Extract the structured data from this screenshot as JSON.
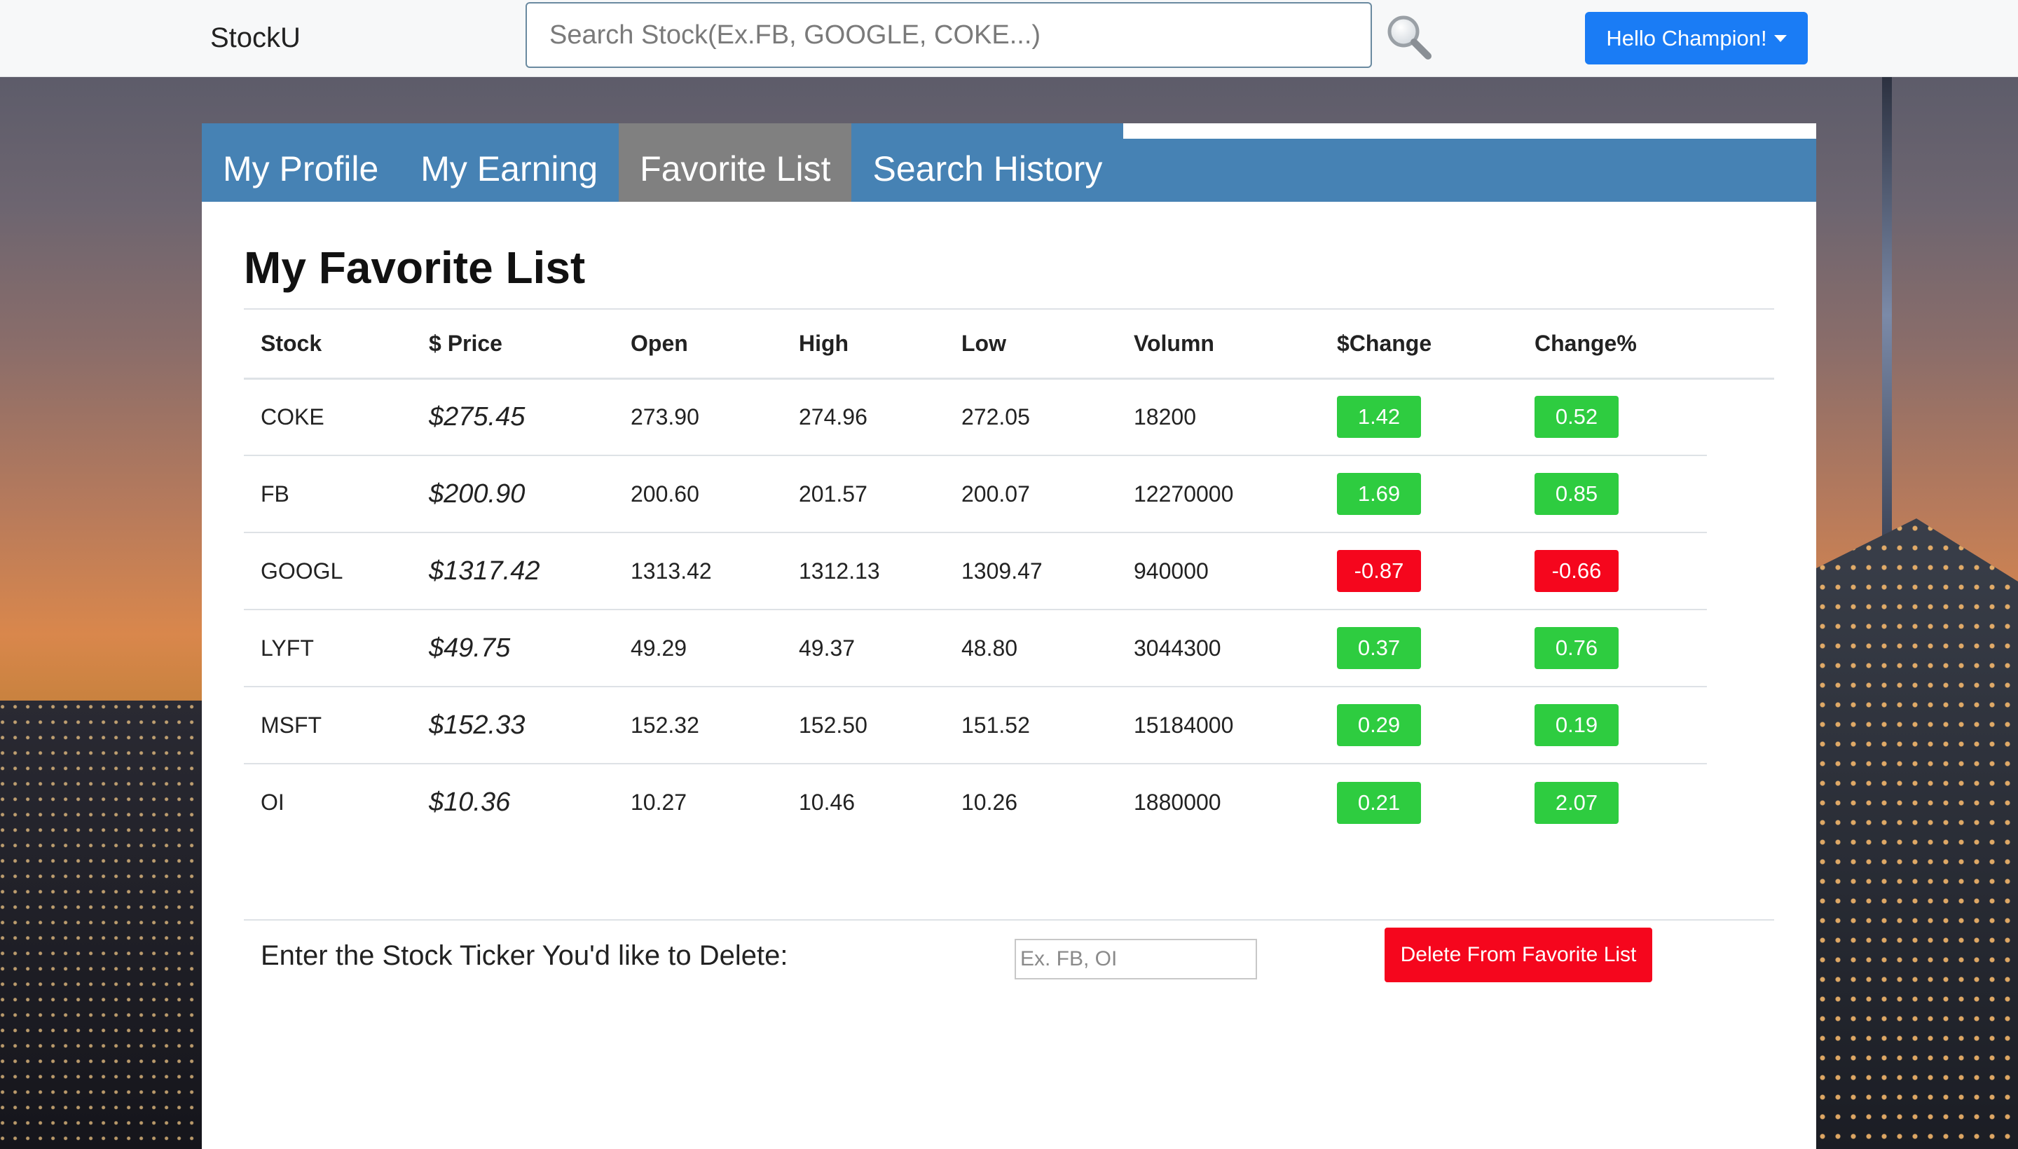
{
  "navbar": {
    "brand": "StockU",
    "search_placeholder": "Search Stock(Ex.FB, GOOGLE, COKE...)",
    "user_button_label": "Hello Champion!"
  },
  "tabs": [
    {
      "label": "My Profile"
    },
    {
      "label": "My Earning"
    },
    {
      "label": "Favorite List",
      "active": true
    },
    {
      "label": "Search History"
    }
  ],
  "page": {
    "title": "My Favorite List"
  },
  "table": {
    "headers": [
      "Stock",
      "$ Price",
      "Open",
      "High",
      "Low",
      "Volumn",
      "$Change",
      "Change%"
    ],
    "rows": [
      {
        "stock": "COKE",
        "price": "$275.45",
        "open": "273.90",
        "high": "274.96",
        "low": "272.05",
        "volume": "18200",
        "change": "1.42",
        "change_pct": "0.52",
        "direction": "up"
      },
      {
        "stock": "FB",
        "price": "$200.90",
        "open": "200.60",
        "high": "201.57",
        "low": "200.07",
        "volume": "12270000",
        "change": "1.69",
        "change_pct": "0.85",
        "direction": "up"
      },
      {
        "stock": "GOOGL",
        "price": "$1317.42",
        "open": "1313.42",
        "high": "1312.13",
        "low": "1309.47",
        "volume": "940000",
        "change": "-0.87",
        "change_pct": "-0.66",
        "direction": "down"
      },
      {
        "stock": "LYFT",
        "price": "$49.75",
        "open": "49.29",
        "high": "49.37",
        "low": "48.80",
        "volume": "3044300",
        "change": "0.37",
        "change_pct": "0.76",
        "direction": "up"
      },
      {
        "stock": "MSFT",
        "price": "$152.33",
        "open": "152.32",
        "high": "152.50",
        "low": "151.52",
        "volume": "15184000",
        "change": "0.29",
        "change_pct": "0.19",
        "direction": "up"
      },
      {
        "stock": "OI",
        "price": "$10.36",
        "open": "10.27",
        "high": "10.46",
        "low": "10.26",
        "volume": "1880000",
        "change": "0.21",
        "change_pct": "2.07",
        "direction": "up"
      }
    ]
  },
  "delete_form": {
    "label": "Enter the Stock Ticker You'd like to Delete:",
    "placeholder": "Ex. FB, OI",
    "button_label": "Delete From Favorite List"
  },
  "colors": {
    "brand_blue": "#1a7cf5",
    "tab_bar": "#4682b4",
    "tab_active": "#808080",
    "positive": "#2ecc40",
    "negative": "#f5061d"
  },
  "icons": {
    "search": "magnifier-icon",
    "user_menu": "caret-down-icon"
  }
}
